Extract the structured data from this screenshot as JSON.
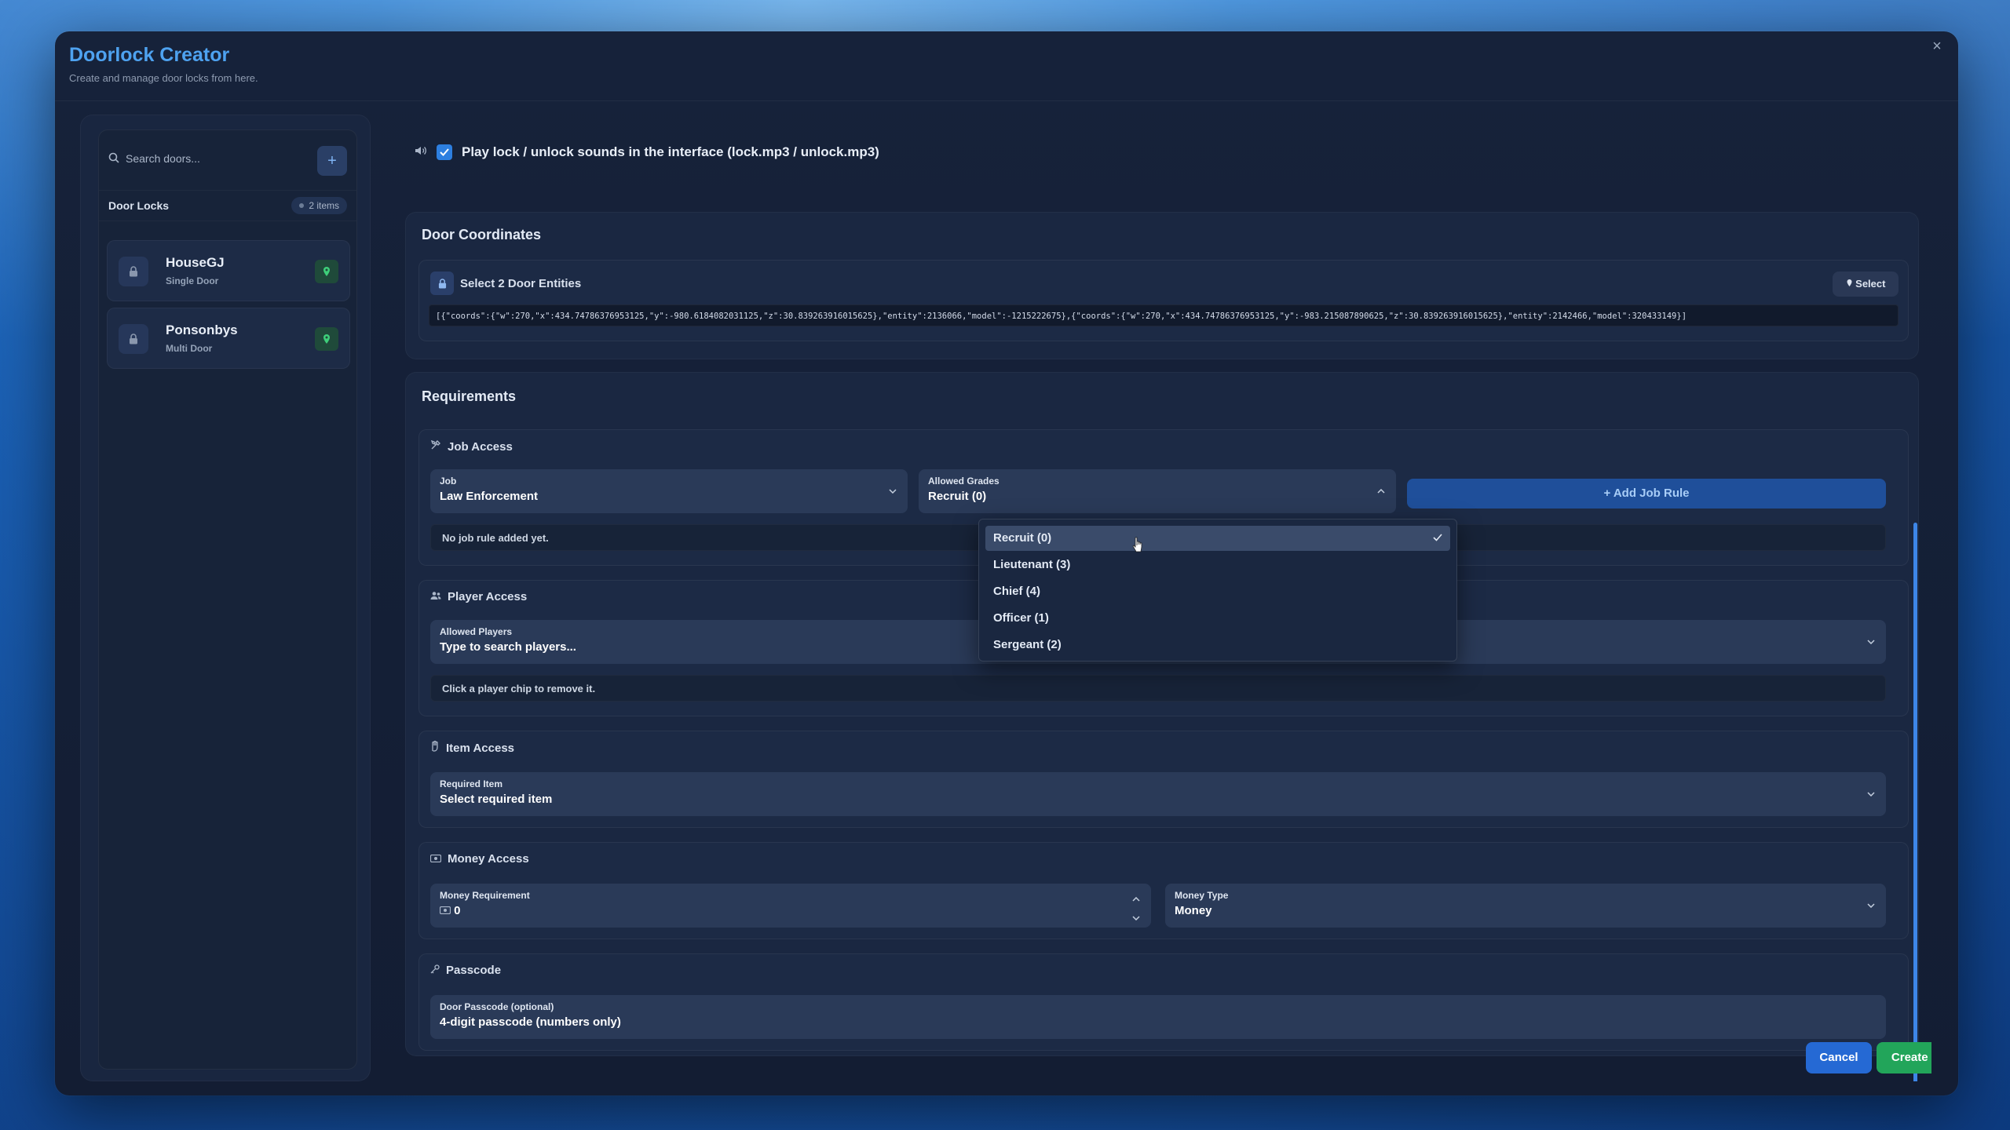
{
  "window": {
    "title": "Doorlock Creator",
    "subtitle": "Create and manage door locks from here.",
    "close_label": "×"
  },
  "sidebar": {
    "search_placeholder": "Search doors...",
    "add_label": "+",
    "section_label": "Door Locks",
    "count_label": "2 items",
    "doors": [
      {
        "name": "HouseGJ",
        "type": "Single Door"
      },
      {
        "name": "Ponsonbys",
        "type": "Multi Door"
      }
    ]
  },
  "sound": {
    "checked": true,
    "label": "Play lock / unlock sounds in the interface (lock.mp3 / unlock.mp3)"
  },
  "coordinates": {
    "title": "Door Coordinates",
    "select_entities_label": "Select 2 Door Entities",
    "select_button": "Select",
    "json_value": "[{\"coords\":{\"w\":270,\"x\":434.74786376953125,\"y\":-980.6184082031125,\"z\":30.839263916015625},\"entity\":2136066,\"model\":-1215222675},{\"coords\":{\"w\":270,\"x\":434.74786376953125,\"y\":-983.215087890625,\"z\":30.839263916015625},\"entity\":2142466,\"model\":320433149}]"
  },
  "requirements": {
    "title": "Requirements",
    "job_access": {
      "title": "Job Access",
      "job_label": "Job",
      "job_value": "Law Enforcement",
      "grades_label": "Allowed Grades",
      "grades_value": "Recruit (0)",
      "add_rule_button": "+ Add Job Rule",
      "empty_text": "No job rule added yet.",
      "grade_options": [
        {
          "label": "Recruit (0)",
          "selected": true
        },
        {
          "label": "Lieutenant (3)",
          "selected": false
        },
        {
          "label": "Chief (4)",
          "selected": false
        },
        {
          "label": "Officer (1)",
          "selected": false
        },
        {
          "label": "Sergeant (2)",
          "selected": false
        }
      ]
    },
    "player_access": {
      "title": "Player Access",
      "players_label": "Allowed Players",
      "players_placeholder": "Type to search players...",
      "hint": "Click a player chip to remove it."
    },
    "item_access": {
      "title": "Item Access",
      "item_label": "Required Item",
      "item_placeholder": "Select required item"
    },
    "money_access": {
      "title": "Money Access",
      "money_label": "Money Requirement",
      "money_value": "0",
      "type_label": "Money Type",
      "type_value": "Money"
    },
    "passcode": {
      "title": "Passcode",
      "passcode_label": "Door Passcode (optional)",
      "passcode_placeholder": "4-digit passcode (numbers only)"
    }
  },
  "footer": {
    "cancel": "Cancel",
    "create": "Create door"
  },
  "colors": {
    "accent": "#2d7fe0",
    "title": "#4ea2f0",
    "success": "#22a55a",
    "cancel": "#2569d4"
  }
}
